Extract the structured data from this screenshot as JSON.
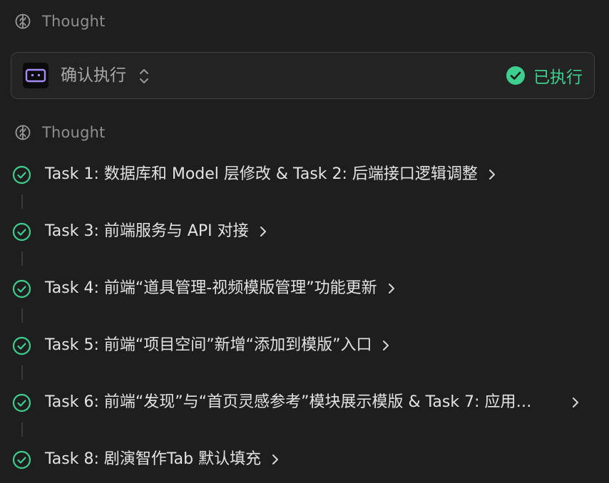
{
  "thoughts": [
    {
      "label": "Thought"
    },
    {
      "label": "Thought"
    }
  ],
  "execution_card": {
    "title": "确认执行",
    "status_text": "已执行",
    "app_icon": "bot-face-icon",
    "toggle_icon": "chevron-updown-icon",
    "status_icon": "check-circle-filled-icon"
  },
  "tasks": [
    {
      "text": "Task 1: 数据库和 Model 层修改 & Task 2: 后端接口逻辑调整",
      "status": "done"
    },
    {
      "text": "Task 3: 前端服务与 API 对接",
      "status": "done"
    },
    {
      "text": "Task 4: 前端“道具管理-视频模版管理”功能更新",
      "status": "done"
    },
    {
      "text": "Task 5: 前端“项目空间”新增“添加到模版”入口",
      "status": "done"
    },
    {
      "text": "Task 6: 前端“发现”与“首页灵感参考”模块展示模版 & Task 7: 应用…",
      "status": "done"
    },
    {
      "text": "Task 8: 剧演智作Tab 默认填充",
      "status": "done"
    }
  ],
  "colors": {
    "background": "#1e1e1e",
    "success": "#3ecf8e",
    "muted_text": "#8f8f8f",
    "accent_icon": "#a78bfa"
  }
}
